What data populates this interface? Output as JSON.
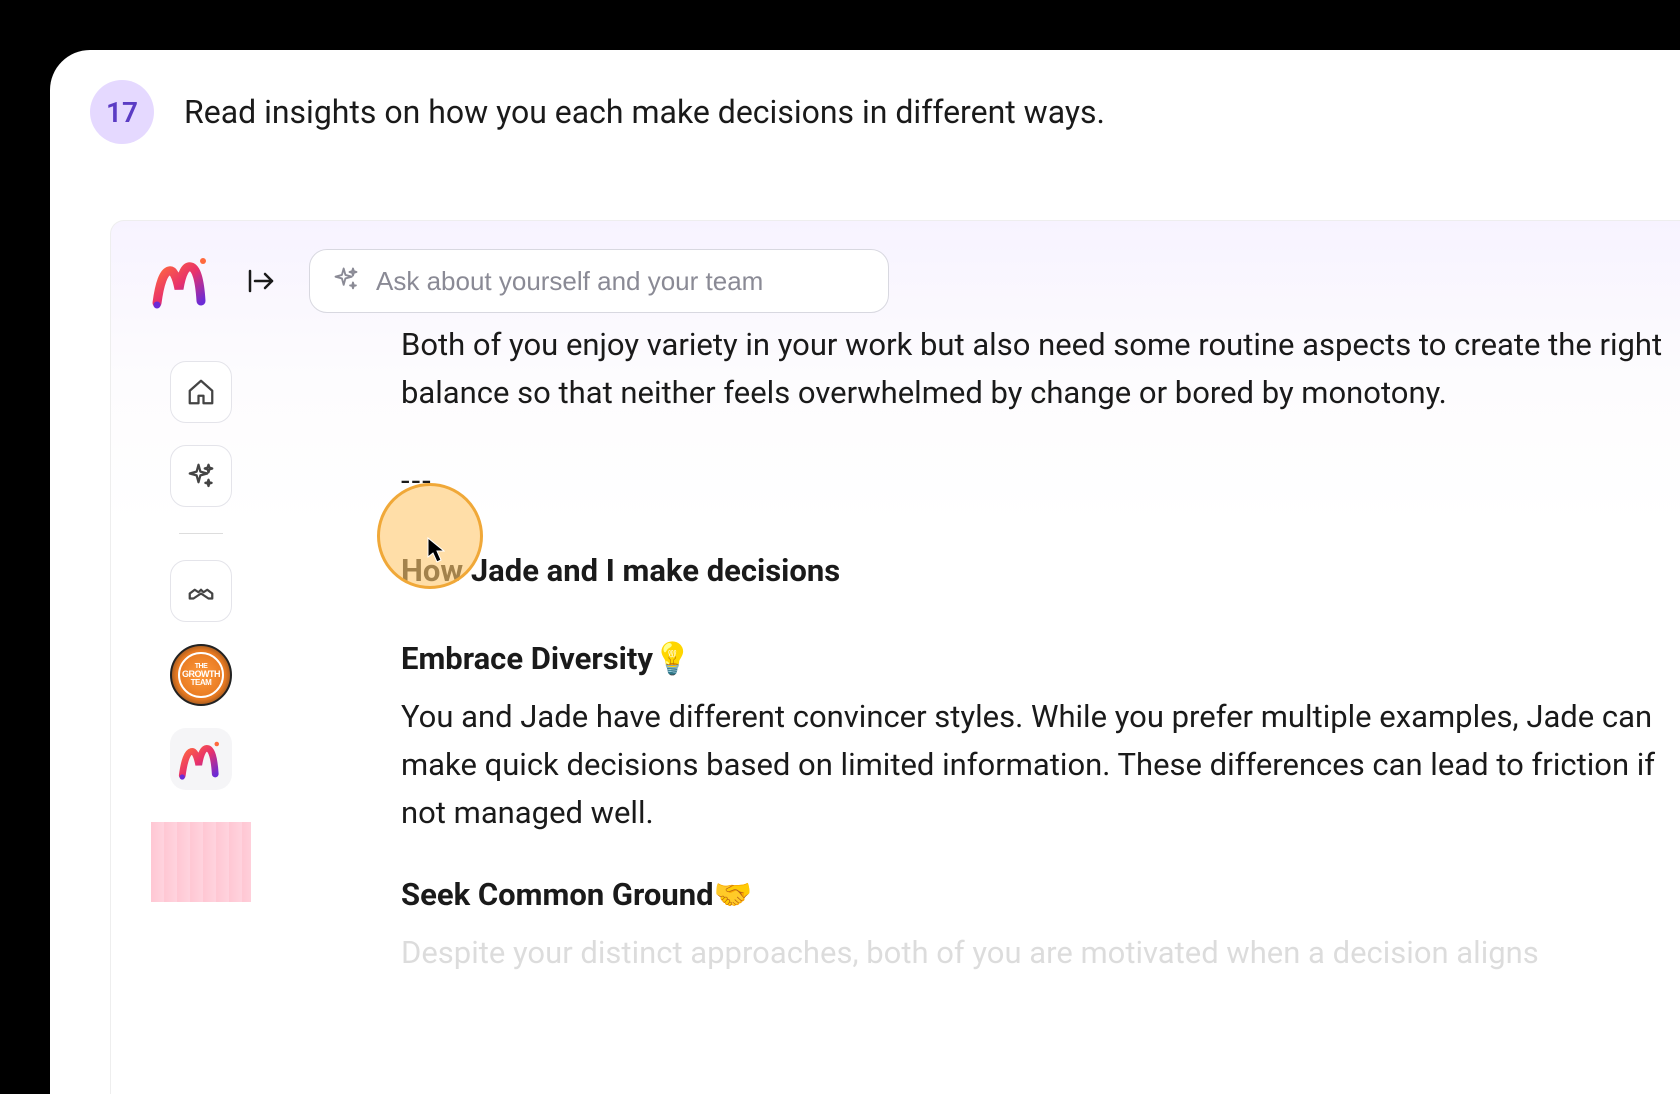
{
  "instruction": {
    "step": "17",
    "text": "Read insights on how you each make decisions in different ways."
  },
  "search": {
    "placeholder": "Ask about yourself and your team"
  },
  "content": {
    "intro_paragraph": "Both of you enjoy variety in your work but also need some routine aspects to create the right balance so that neither feels overwhelmed by change or bored by monotony.",
    "divider": "---",
    "heading": "How Jade and I make decisions",
    "section1_title": "Embrace Diversity",
    "section1_emoji": "💡",
    "section1_body": "You and Jade have different convincer styles. While you prefer multiple examples, Jade can make quick decisions based on limited information. These differences can lead to friction if not managed well.",
    "section2_title": "Seek Common Ground",
    "section2_emoji": "🤝",
    "section2_body": "Despite your distinct approaches, both of you are motivated when a decision aligns"
  },
  "sidebar": {
    "home": "home-icon",
    "sparkle": "sparkle-icon",
    "handshake": "handshake-icon",
    "growth_label_1": "THE",
    "growth_label_2": "GROWTH",
    "growth_label_3": "TEAM"
  }
}
